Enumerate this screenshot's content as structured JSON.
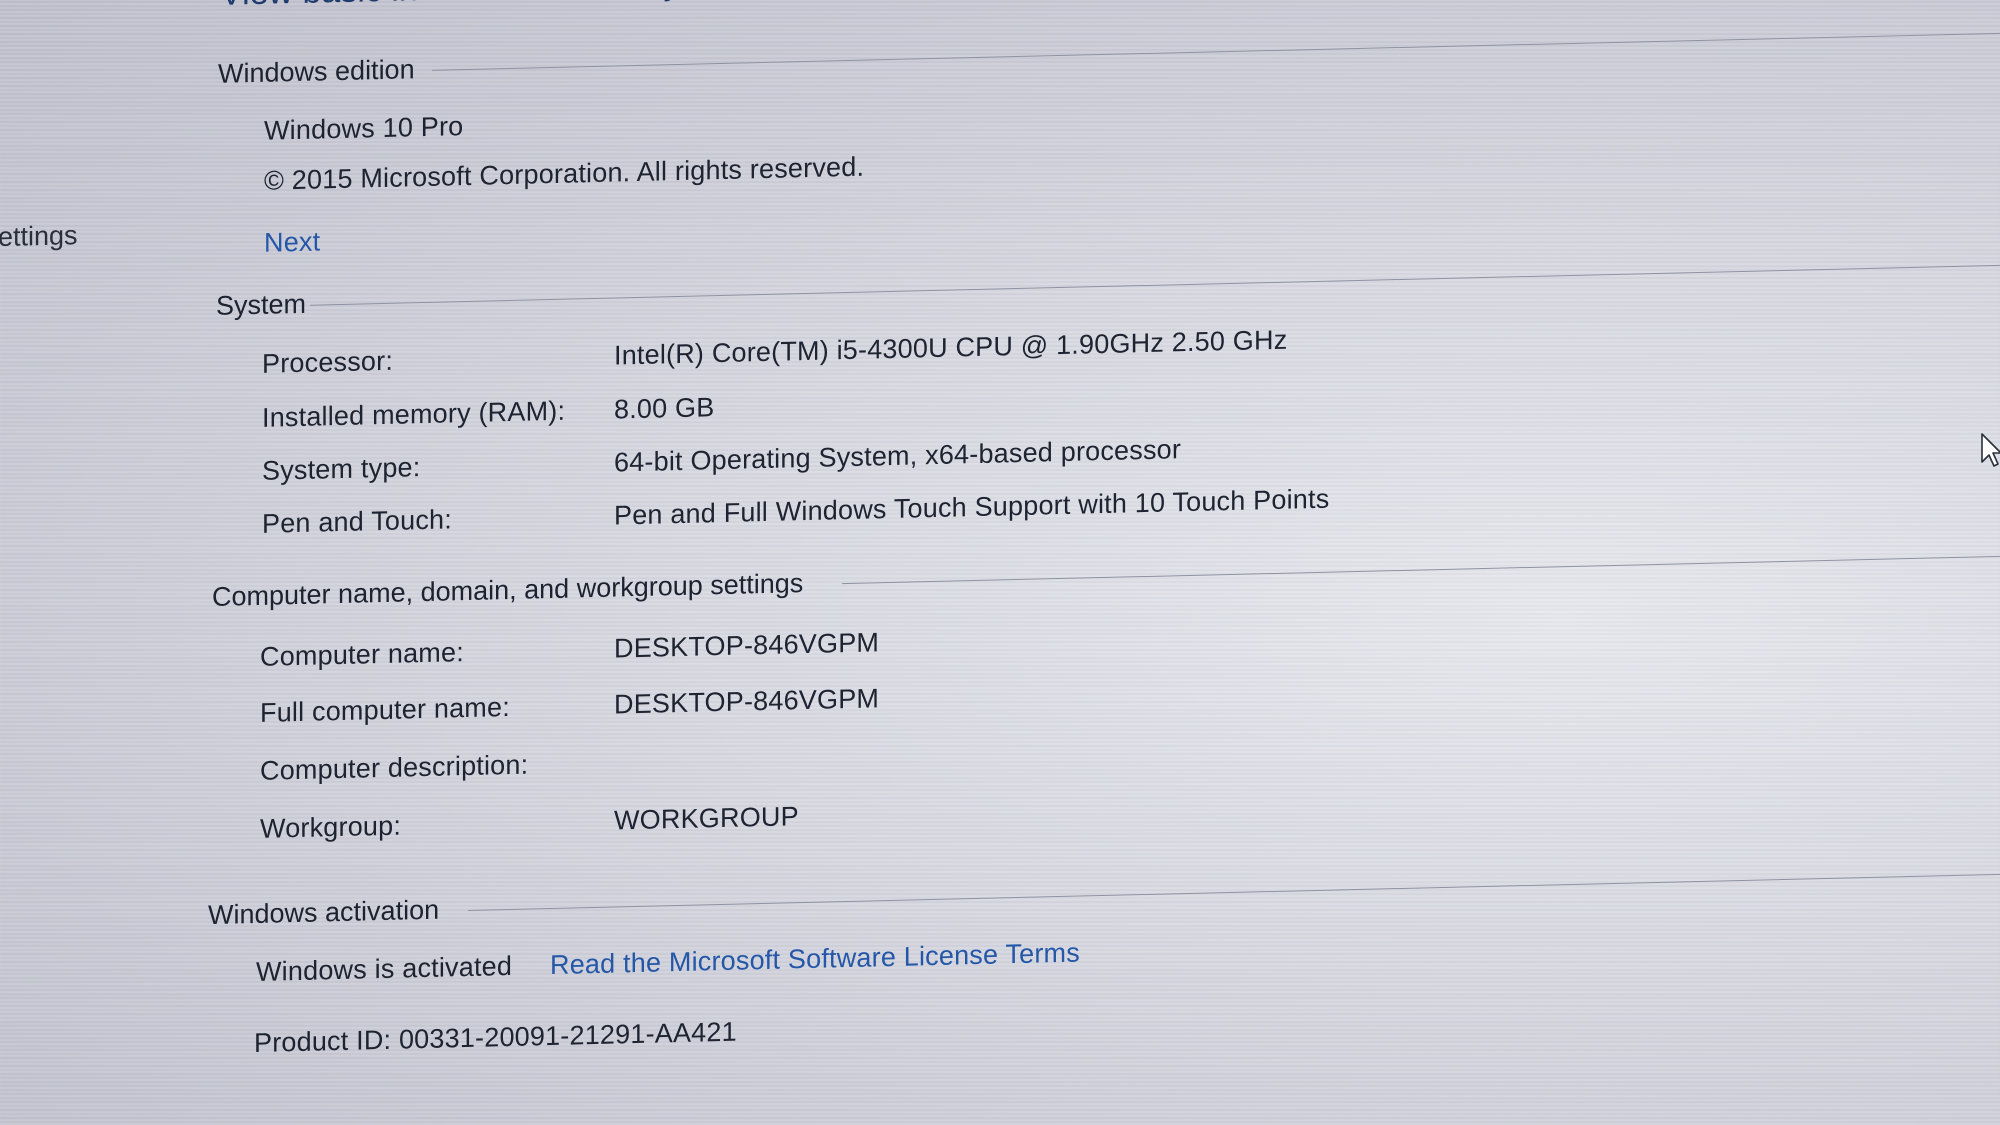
{
  "page": {
    "title": "View basic information about your computer"
  },
  "sidebar": {
    "partial_label": "ettings"
  },
  "edition": {
    "header": "Windows edition",
    "name": "Windows 10 Pro",
    "copyright": "© 2015 Microsoft Corporation. All rights reserved.",
    "next_link": "Next"
  },
  "system": {
    "header": "System",
    "rows": [
      {
        "label": "Processor:",
        "value": "Intel(R) Core(TM) i5-4300U CPU @ 1.90GHz   2.50 GHz"
      },
      {
        "label": "Installed memory (RAM):",
        "value": "8.00 GB"
      },
      {
        "label": "System type:",
        "value": "64-bit Operating System, x64-based processor"
      },
      {
        "label": "Pen and Touch:",
        "value": "Pen and Full Windows Touch Support with 10 Touch Points"
      }
    ]
  },
  "computer_name": {
    "header": "Computer name, domain, and workgroup settings",
    "rows": [
      {
        "label": "Computer name:",
        "value": "DESKTOP-846VGPM"
      },
      {
        "label": "Full computer name:",
        "value": "DESKTOP-846VGPM"
      },
      {
        "label": "Computer description:",
        "value": ""
      },
      {
        "label": "Workgroup:",
        "value": "WORKGROUP"
      }
    ]
  },
  "activation": {
    "header": "Windows activation",
    "status": "Windows is activated",
    "license_link": "Read the Microsoft Software License Terms",
    "product_id": "Product ID: 00331-20091-21291-AA421"
  },
  "colors": {
    "link": "#2457a8",
    "title": "#1f3a6e",
    "text": "#1e2331"
  },
  "icons": {
    "cursor": "mouse-pointer-icon"
  }
}
